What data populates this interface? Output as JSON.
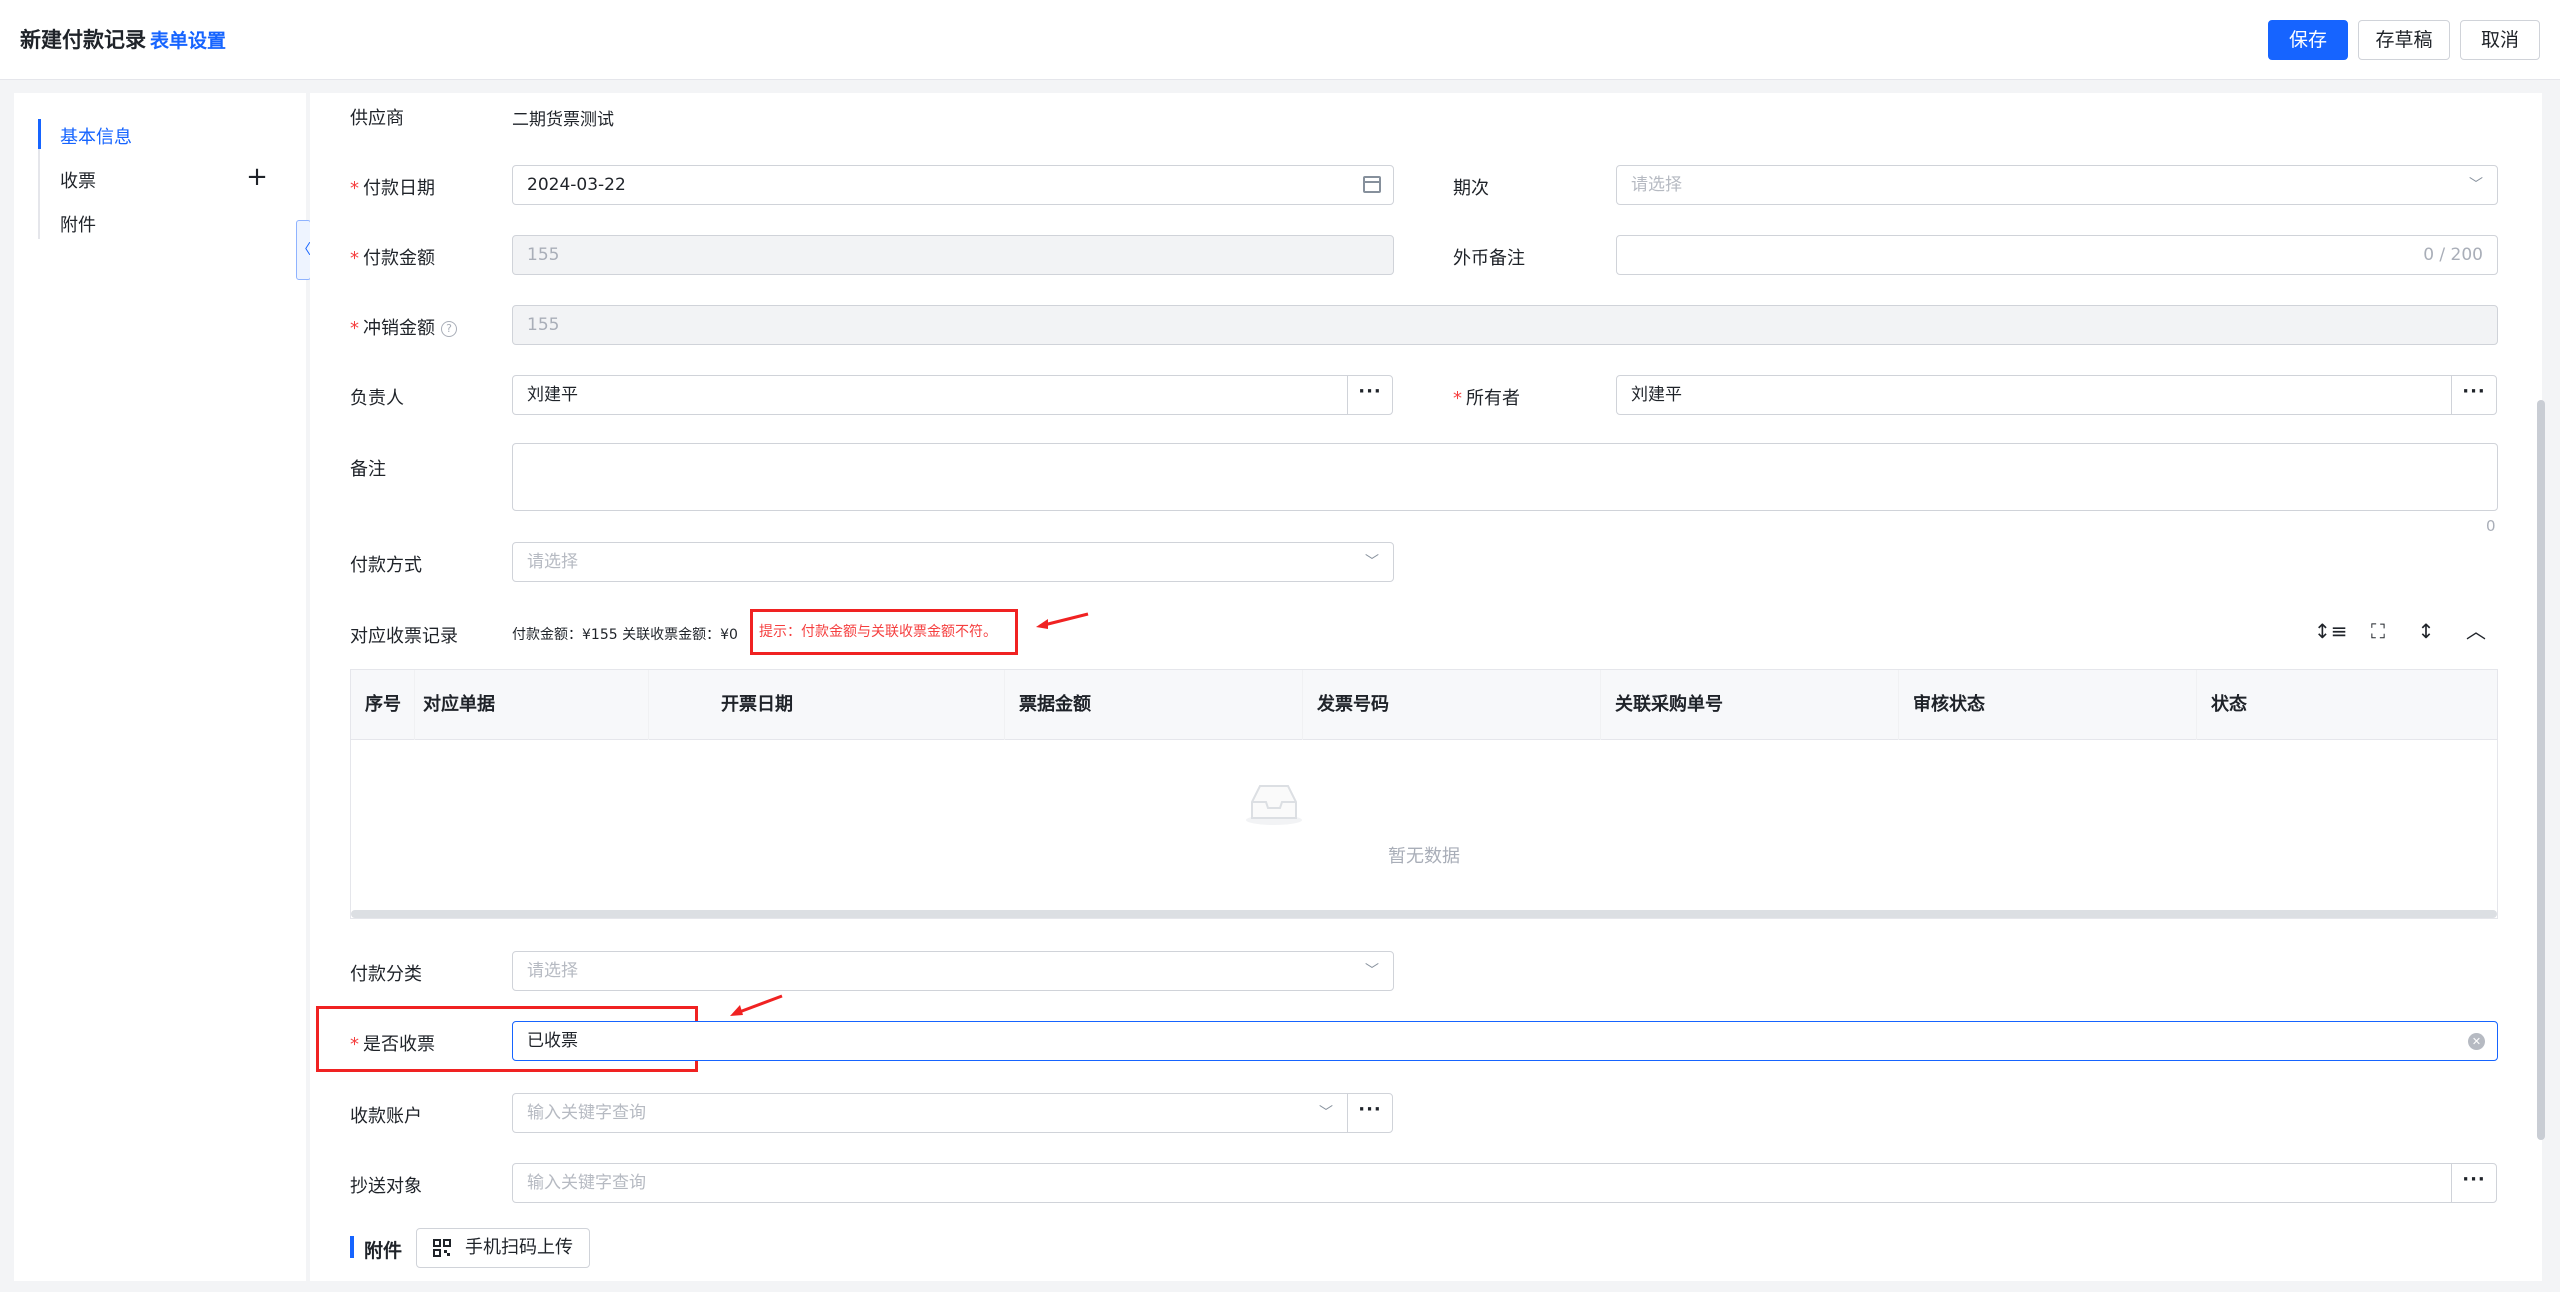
{
  "header": {
    "title": "新建付款记录",
    "form_settings": "表单设置",
    "save": "保存",
    "draft": "存草稿",
    "cancel": "取消"
  },
  "sidebar": {
    "items": [
      {
        "label": "基本信息",
        "active": true
      },
      {
        "label": "收票",
        "active": false
      },
      {
        "label": "附件",
        "active": false
      }
    ],
    "collapse_glyph": "〈"
  },
  "form": {
    "supplier_label": "供应商",
    "supplier_value": "二期货票测试",
    "payment_date_label": "付款日期",
    "payment_date_value": "2024-03-22",
    "period_label": "期次",
    "period_placeholder": "请选择",
    "payment_amount_label": "付款金额",
    "payment_amount_value": "155",
    "currency_note_label": "外币备注",
    "currency_note_counter": "0 / 200",
    "writeoff_label": "冲销金额",
    "writeoff_value": "155",
    "owner_person_label": "负责人",
    "owner_person_value": "刘建平",
    "owner_label": "所有者",
    "owner_value": "刘建平",
    "remark_label": "备注",
    "remark_counter": "0",
    "payment_method_label": "付款方式",
    "payment_method_placeholder": "请选择",
    "invoice_records_label": "对应收票记录",
    "amount_summary": "付款金额：¥155   关联收票金额：¥0",
    "tip": "提示：付款金额与关联收票金额不符。",
    "payment_category_label": "付款分类",
    "payment_category_placeholder": "请选择",
    "invoice_received_label": "是否收票",
    "invoice_received_value": "已收票",
    "account_label": "收款账户",
    "account_placeholder": "输入关键字查询",
    "cc_label": "抄送对象",
    "cc_placeholder": "输入关键字查询",
    "attachment_title": "附件",
    "upload_button": "手机扫码上传",
    "more_glyph": "···"
  },
  "table": {
    "columns": [
      "序号",
      "对应单据",
      "开票日期",
      "票据金额",
      "发票号码",
      "关联采购单号",
      "审核状态",
      "状态"
    ],
    "empty_text": "暂无数据"
  },
  "colors": {
    "primary": "#1664ff",
    "required": "#f53f3f",
    "annotation": "#f02222"
  }
}
